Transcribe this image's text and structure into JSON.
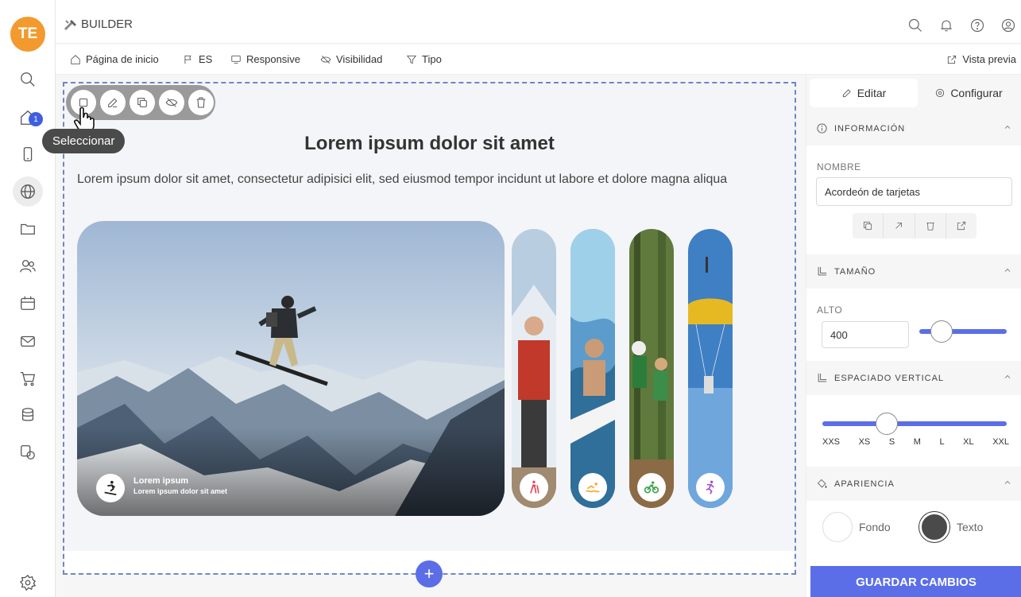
{
  "sidebar": {
    "avatar_initials": "TE",
    "home_badge": "1",
    "icons": [
      "search-icon",
      "home-icon",
      "mobile-icon",
      "globe-icon",
      "folder-icon",
      "users-icon",
      "calendar-icon",
      "mail-icon",
      "cart-icon",
      "database-icon",
      "shapes-icon",
      "settings-icon"
    ]
  },
  "topbar": {
    "brand": "BUILDER"
  },
  "toolbar": {
    "home": "Página de inicio",
    "lang": "ES",
    "responsive": "Responsive",
    "visibility": "Visibilidad",
    "type": "Tipo",
    "preview": "Vista previa"
  },
  "canvas": {
    "tooltip": "Seleccionar",
    "heading": "Lorem ipsum dolor sit amet",
    "subtext": "Lorem ipsum dolor sit amet, consectetur adipisici elit, sed eiusmod tempor incidunt ut labore et dolore magna aliqua",
    "card_title": "Lorem ipsum",
    "card_sub": "Lorem ipsum dolor sit amet",
    "add": "+"
  },
  "panel": {
    "tab_edit": "Editar",
    "tab_config": "Configurar",
    "info_title": "INFORMACIÓN",
    "name_label": "NOMBRE",
    "name_value": "Acordeón de tarjetas",
    "size_title": "TAMAÑO",
    "height_label": "ALTO",
    "height_value": "400",
    "height_slider_fraction": 0.25,
    "spacing_title": "ESPACIADO VERTICAL",
    "spacing_options": [
      "XXS",
      "XS",
      "S",
      "M",
      "L",
      "XL",
      "XXL"
    ],
    "spacing_selected": "S",
    "appearance_title": "APARIENCIA",
    "bg_label": "Fondo",
    "text_label": "Texto",
    "bg_color": "#ffffff",
    "text_color": "#4a4a4a",
    "save": "GUARDAR CAMBIOS"
  },
  "colors": {
    "accent": "#5b6ee8",
    "avatar": "#f29a2e",
    "selection_border": "#6f86c9"
  }
}
